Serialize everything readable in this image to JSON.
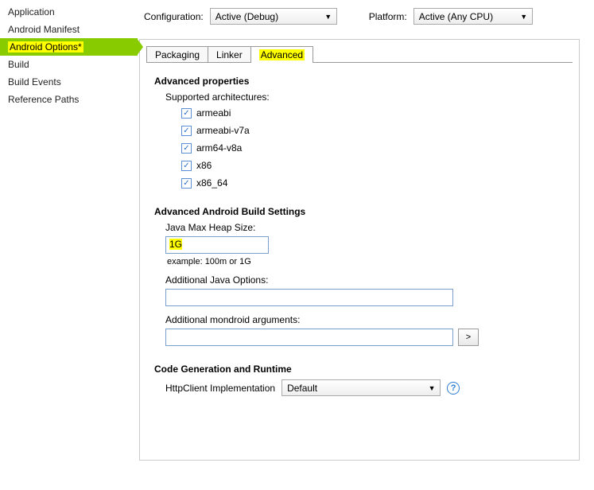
{
  "sidebar": {
    "items": [
      {
        "label": "Application"
      },
      {
        "label": "Android Manifest"
      },
      {
        "label": "Android Options*"
      },
      {
        "label": "Build"
      },
      {
        "label": "Build Events"
      },
      {
        "label": "Reference Paths"
      }
    ]
  },
  "config": {
    "configuration_label": "Configuration:",
    "configuration_value": "Active (Debug)",
    "platform_label": "Platform:",
    "platform_value": "Active (Any CPU)"
  },
  "tabs": [
    {
      "label": "Packaging"
    },
    {
      "label": "Linker"
    },
    {
      "label": "Advanced"
    }
  ],
  "advanced": {
    "header": "Advanced properties",
    "supported_label": "Supported architectures:",
    "architectures": [
      {
        "label": "armeabi",
        "checked": true
      },
      {
        "label": "armeabi-v7a",
        "checked": true
      },
      {
        "label": "arm64-v8a",
        "checked": true
      },
      {
        "label": "x86",
        "checked": true
      },
      {
        "label": "x86_64",
        "checked": true
      }
    ],
    "build_header": "Advanced Android Build Settings",
    "heap_label": "Java Max Heap Size:",
    "heap_value": "1G",
    "heap_example": "example: 100m or 1G",
    "java_options_label": "Additional Java Options:",
    "java_options_value": "",
    "mondroid_label": "Additional mondroid arguments:",
    "mondroid_value": "",
    "expand_btn": ">",
    "codegen_header": "Code Generation and Runtime",
    "httpclient_label": "HttpClient Implementation",
    "httpclient_value": "Default",
    "help_glyph": "?"
  }
}
